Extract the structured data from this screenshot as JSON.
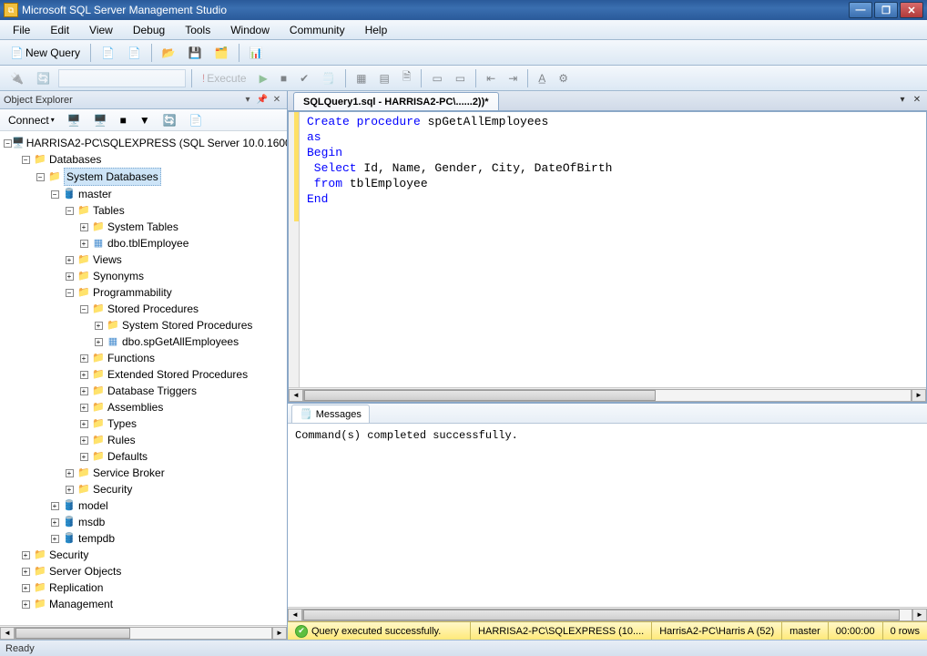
{
  "window": {
    "title": "Microsoft SQL Server Management Studio"
  },
  "menu": [
    "File",
    "Edit",
    "View",
    "Debug",
    "Tools",
    "Window",
    "Community",
    "Help"
  ],
  "toolbar1": {
    "new_query": "New Query"
  },
  "toolbar2": {
    "execute": "Execute",
    "debug": "▶"
  },
  "object_explorer": {
    "title": "Object Explorer",
    "connect": "Connect",
    "root": "HARRISA2-PC\\SQLEXPRESS (SQL Server 10.0.1600",
    "databases": "Databases",
    "system_databases": "System Databases",
    "master": "master",
    "tables": "Tables",
    "system_tables": "System Tables",
    "dbo_tblEmployee": "dbo.tblEmployee",
    "views": "Views",
    "synonyms": "Synonyms",
    "programmability": "Programmability",
    "stored_procedures": "Stored Procedures",
    "system_stored_procedures": "System Stored Procedures",
    "dbo_spGetAllEmployees": "dbo.spGetAllEmployees",
    "functions": "Functions",
    "extended_stored_procedures": "Extended Stored Procedures",
    "database_triggers": "Database Triggers",
    "assemblies": "Assemblies",
    "types": "Types",
    "rules": "Rules",
    "defaults": "Defaults",
    "service_broker": "Service Broker",
    "security_node": "Security",
    "model": "model",
    "msdb": "msdb",
    "tempdb": "tempdb",
    "security": "Security",
    "server_objects": "Server Objects",
    "replication": "Replication",
    "management": "Management"
  },
  "tab": {
    "label": "SQLQuery1.sql - HARRISA2-PC\\......2))*"
  },
  "code": {
    "l1a": "Create procedure",
    "l1b": " spGetAllEmployees",
    "l2": "as",
    "l3": "Begin",
    "l4a": " Select",
    "l4b": " Id, Name, Gender, City, DateOfBirth",
    "l5a": " from",
    "l5b": " tblEmployee",
    "l6": "End"
  },
  "messages": {
    "tab": "Messages",
    "text": "Command(s) completed successfully."
  },
  "query_status": {
    "ok": "Query executed successfully.",
    "server": "HARRISA2-PC\\SQLEXPRESS (10....",
    "user": "HarrisA2-PC\\Harris A (52)",
    "db": "master",
    "time": "00:00:00",
    "rows": "0 rows"
  },
  "main_status": "Ready"
}
